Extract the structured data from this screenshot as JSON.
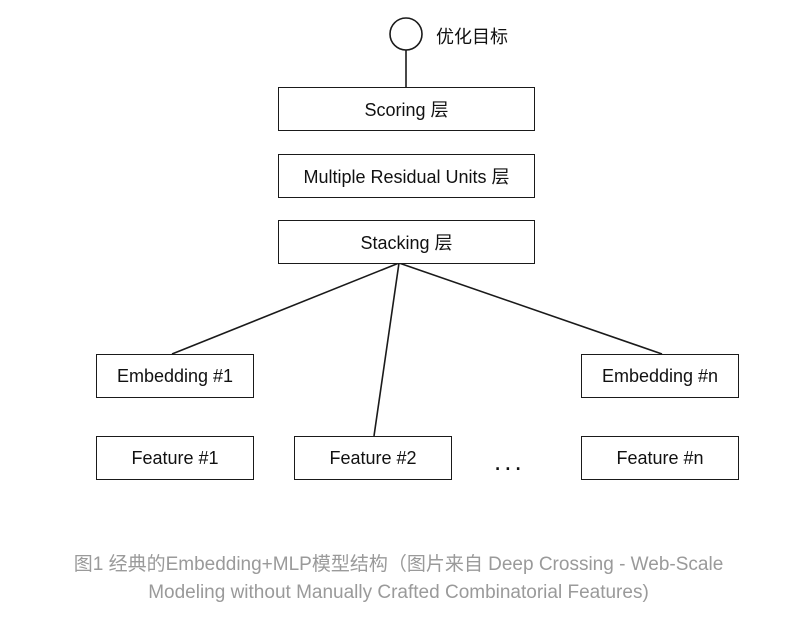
{
  "diagram": {
    "target_label": "优化目标",
    "scoring_layer": "Scoring 层",
    "residual_layer": "Multiple Residual Units 层",
    "stacking_layer": "Stacking 层",
    "embedding_1": "Embedding #1",
    "embedding_n": "Embedding #n",
    "feature_1": "Feature #1",
    "feature_2": "Feature #2",
    "feature_n": "Feature #n",
    "ellipsis": "..."
  },
  "caption": {
    "line1": "图1 经典的Embedding+MLP模型结构（图片来自 Deep Crossing - Web-Scale",
    "line2": "Modeling without Manually Crafted Combinatorial Features)"
  }
}
